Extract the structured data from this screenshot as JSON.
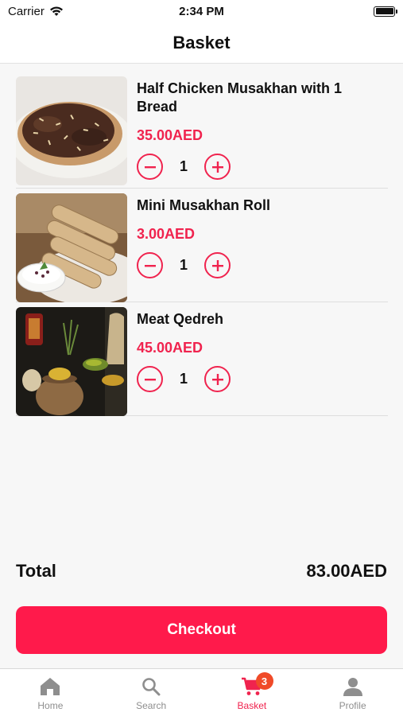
{
  "status_bar": {
    "carrier": "Carrier",
    "time": "2:34 PM"
  },
  "header": {
    "title": "Basket"
  },
  "items": [
    {
      "name": "Half Chicken Musakhan with 1 Bread",
      "price": "35.00AED",
      "quantity": "1",
      "image": "musakhan-plate"
    },
    {
      "name": "Mini Musakhan Roll",
      "price": "3.00AED",
      "quantity": "1",
      "image": "musakhan-rolls"
    },
    {
      "name": "Meat Qedreh",
      "price": "45.00AED",
      "quantity": "1",
      "image": "qedreh-pot"
    }
  ],
  "total": {
    "label": "Total",
    "value": "83.00AED"
  },
  "checkout": {
    "label": "Checkout"
  },
  "tabs": [
    {
      "label": "Home",
      "icon": "home-icon",
      "active": false
    },
    {
      "label": "Search",
      "icon": "search-icon",
      "active": false
    },
    {
      "label": "Basket",
      "icon": "cart-icon",
      "active": true,
      "badge": "3"
    },
    {
      "label": "Profile",
      "icon": "user-icon",
      "active": false
    }
  ],
  "colors": {
    "accent": "#f0234e",
    "checkout": "#ff1a4b",
    "badge": "#f04a28",
    "inactive_tab": "#8e8e8e"
  }
}
